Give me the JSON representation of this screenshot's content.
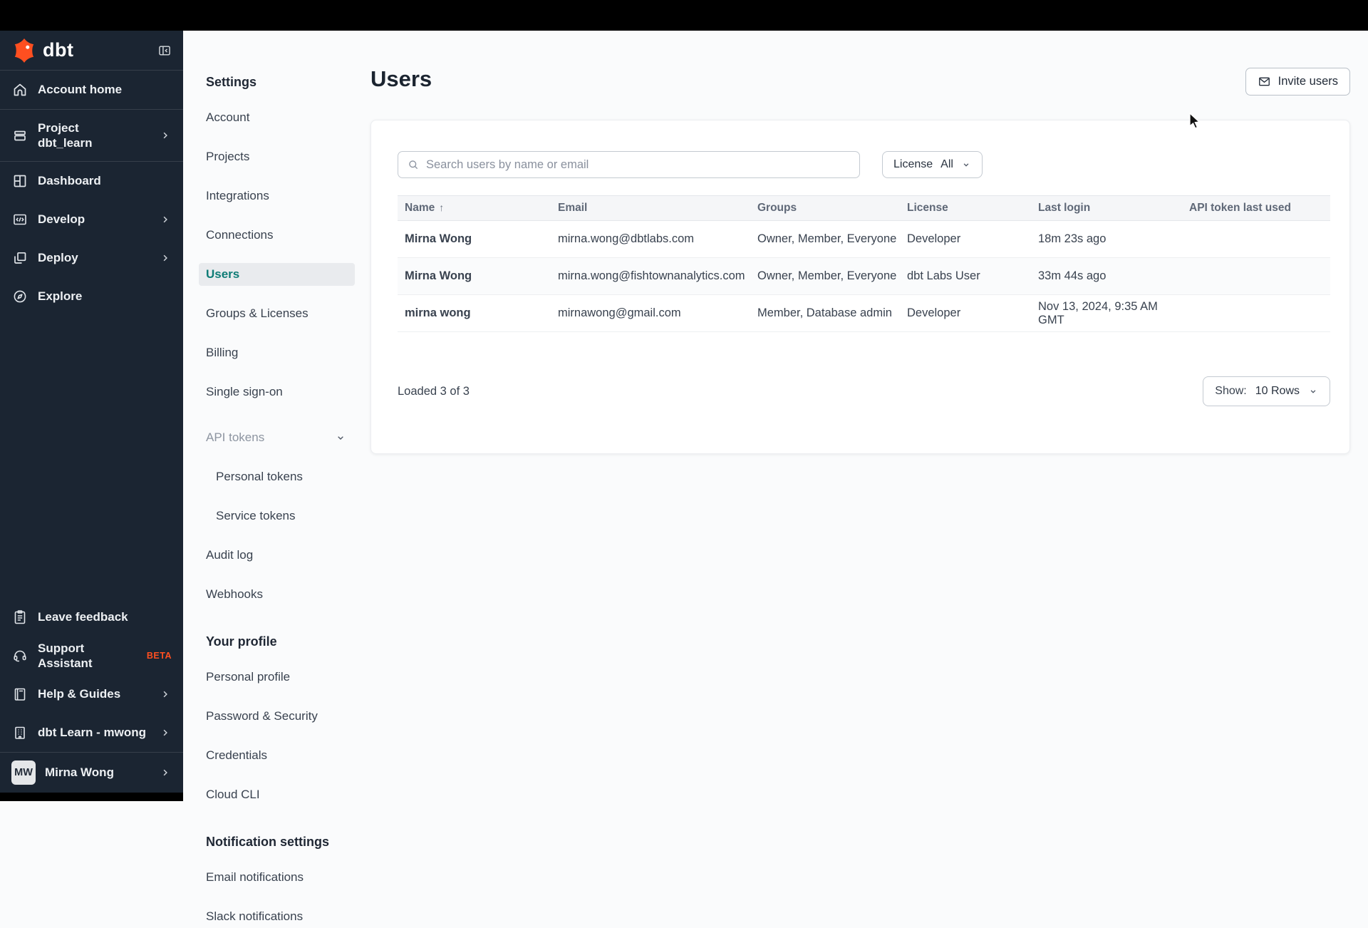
{
  "sidebar": {
    "logo_text": "dbt",
    "items": [
      {
        "label": "Account home"
      },
      {
        "label": "Project",
        "sublabel": "dbt_learn"
      },
      {
        "label": "Dashboard"
      },
      {
        "label": "Develop"
      },
      {
        "label": "Deploy"
      },
      {
        "label": "Explore"
      }
    ],
    "footer_items": [
      {
        "label": "Leave feedback"
      },
      {
        "label": "Support Assistant",
        "badge": "BETA"
      },
      {
        "label": "Help & Guides"
      },
      {
        "label": "dbt Learn - mwong"
      }
    ],
    "user": {
      "initials": "MW",
      "name": "Mirna Wong"
    }
  },
  "settings_nav": {
    "title": "Settings",
    "items": {
      "account": "Account",
      "projects": "Projects",
      "integrations": "Integrations",
      "connections": "Connections",
      "users": "Users",
      "groups": "Groups & Licenses",
      "billing": "Billing",
      "sso": "Single sign-on",
      "api_tokens": "API tokens",
      "personal_tokens": "Personal tokens",
      "service_tokens": "Service tokens",
      "audit_log": "Audit log",
      "webhooks": "Webhooks"
    },
    "profile_title": "Your profile",
    "profile_items": {
      "personal_profile": "Personal profile",
      "password_security": "Password & Security",
      "credentials": "Credentials",
      "cloud_cli": "Cloud CLI"
    },
    "notifications_title": "Notification settings",
    "notification_items": {
      "email": "Email notifications",
      "slack": "Slack notifications"
    }
  },
  "main": {
    "title": "Users",
    "invite_button": "Invite users",
    "search_placeholder": "Search users by name or email",
    "license_filter": {
      "label": "License",
      "value": "All"
    },
    "table": {
      "headers": {
        "name": "Name",
        "email": "Email",
        "groups": "Groups",
        "license": "License",
        "last_login": "Last login",
        "api_token": "API token last used"
      },
      "sort_arrow": "↑",
      "rows": [
        {
          "name": "Mirna Wong",
          "email": "mirna.wong@dbtlabs.com",
          "groups": "Owner, Member, Everyone",
          "license": "Developer",
          "last_login": "18m 23s ago",
          "api_token": ""
        },
        {
          "name": "Mirna Wong",
          "email": "mirna.wong@fishtownanalytics.com",
          "groups": "Owner, Member, Everyone",
          "license": "dbt Labs User",
          "last_login": "33m 44s ago",
          "api_token": ""
        },
        {
          "name": "mirna wong",
          "email": "mirnawong@gmail.com",
          "groups": "Member, Database admin",
          "license": "Developer",
          "last_login": "Nov 13, 2024, 9:35 AM GMT",
          "api_token": ""
        }
      ]
    },
    "footer": {
      "loaded": "Loaded 3 of 3",
      "show_label": "Show:",
      "show_value": "10 Rows"
    }
  },
  "colors": {
    "accent_orange": "#ff4f20",
    "sidebar_bg": "#1b2532",
    "selected_teal": "#0e7c76",
    "topbar": "#000000"
  }
}
